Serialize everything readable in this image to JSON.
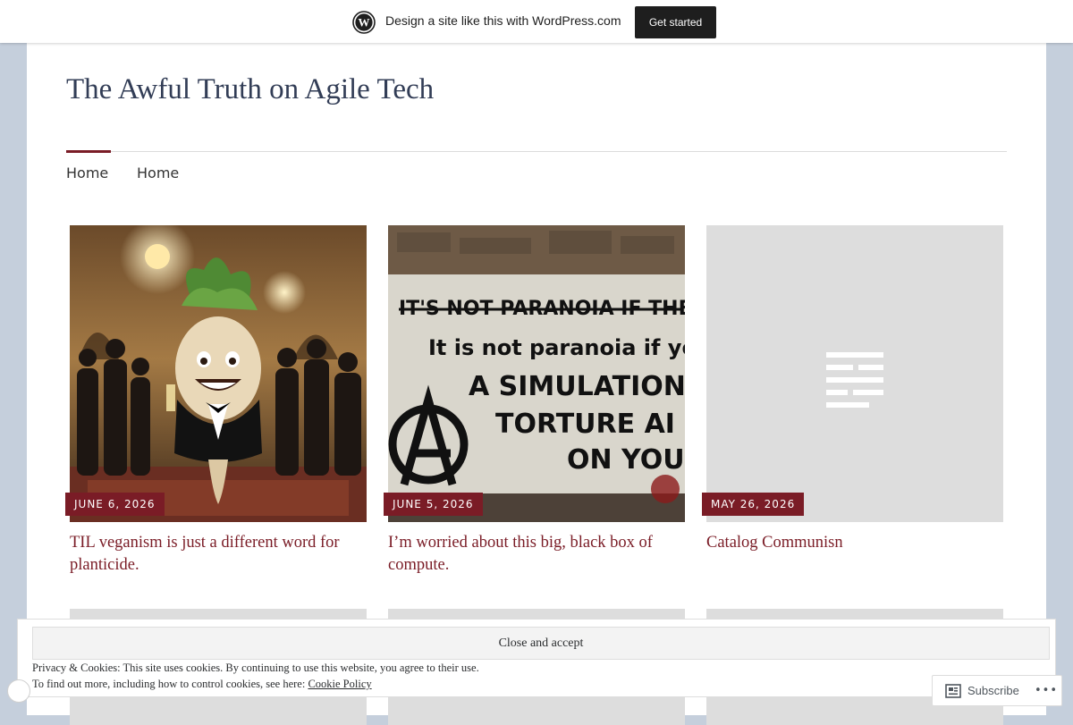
{
  "promo_bar": {
    "logo_icon": "wordpress-logo-icon",
    "text": "Design a site like this with WordPress.com",
    "cta_label": "Get started"
  },
  "site": {
    "title": "The Awful Truth on Agile Tech"
  },
  "nav": {
    "items": [
      {
        "label": "Home",
        "active": true
      },
      {
        "label": "Home",
        "active": false
      }
    ]
  },
  "posts": [
    {
      "date": "JUNE 6, 2026",
      "title": "TIL veganism is just a different word for planticide.",
      "image": "photo-radish-gala"
    },
    {
      "date": "JUNE 5, 2026",
      "title": "I’m worried about this big, black box of compute.",
      "image": "photo-graffiti-wall",
      "image_text": [
        "IT'S NOT PARANOIA IF THEY ARE AFT",
        "It is not paranoia if you are in",
        "A SIMULATION RUN B",
        "TORTURE AI SPY",
        "ON YOU!"
      ]
    },
    {
      "date": "MAY 26, 2026",
      "title": "Catalog Communisn",
      "image": "text-post-placeholder-icon"
    }
  ],
  "cookie_banner": {
    "button_label": "Close and accept",
    "line1": "Privacy & Cookies: This site uses cookies. By continuing to use this website, you agree to their use.",
    "line2_prefix": "To find out more, including how to control cookies, see here: ",
    "link_label": "Cookie Policy"
  },
  "subscribe": {
    "label": "Subscribe",
    "more_label": "•••"
  },
  "colors": {
    "accent": "#7a1c26",
    "title": "#323d56",
    "outer_bg": "#c5cfdc",
    "placeholder_bg": "#dddddd"
  }
}
